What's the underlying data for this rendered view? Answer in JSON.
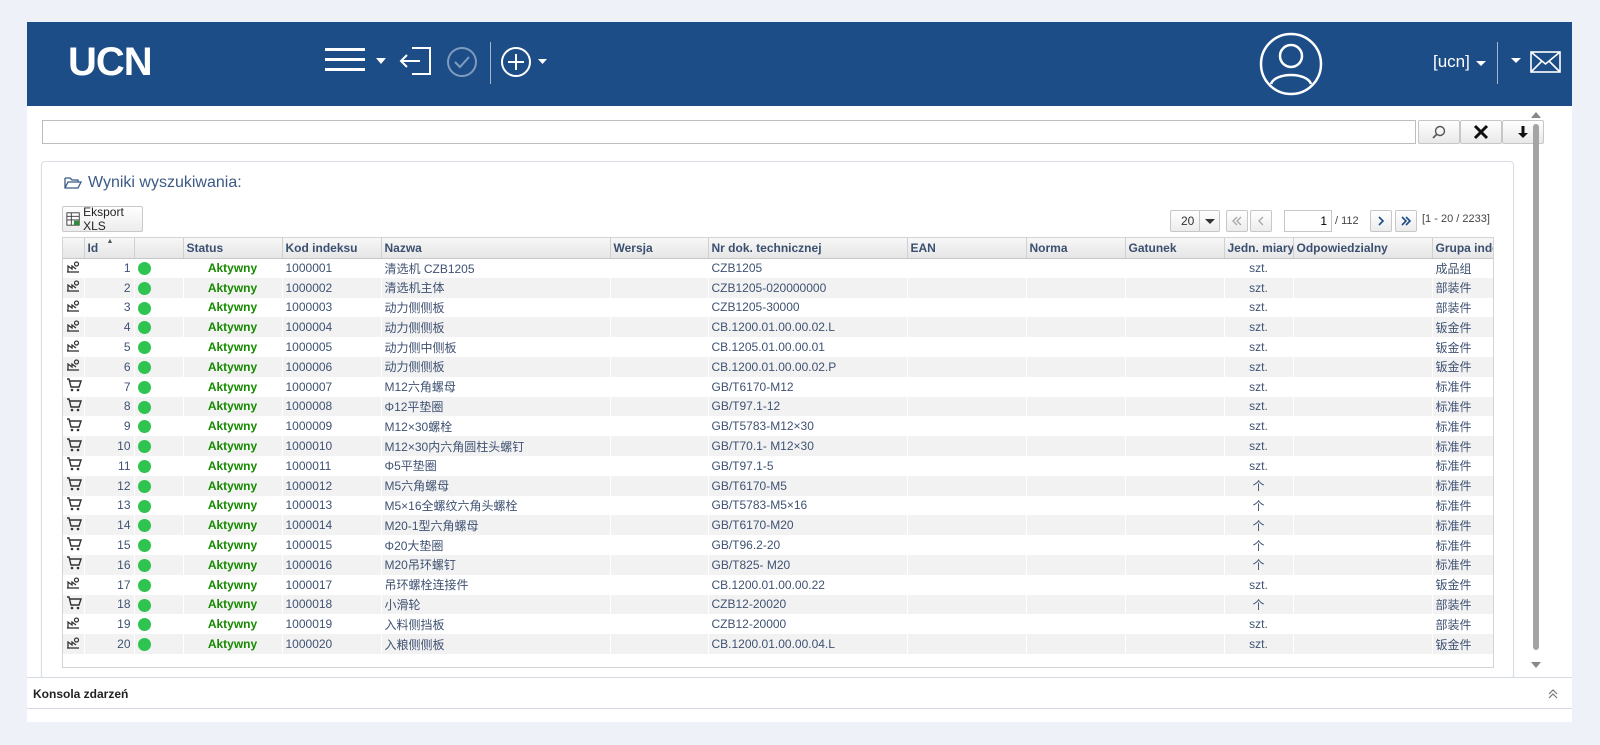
{
  "header": {
    "logo": "UCN",
    "user_name": "[ucn]"
  },
  "search": {
    "value": "",
    "placeholder": ""
  },
  "results": {
    "title": "Wyniki wyszukiwania:",
    "export_label": "Eksport XLS"
  },
  "pagination": {
    "page_size": "20",
    "current_page": "1",
    "total_pages": "/ 112",
    "range": "[1 - 20 / 2233]"
  },
  "columns": [
    "Id",
    "Status",
    "Kod indeksu",
    "Nazwa",
    "Wersja",
    "Nr dok. technicznej",
    "EAN",
    "Norma",
    "Gatunek",
    "Jedn. miary",
    "Odpowiedzialny",
    "Grupa indeksów"
  ],
  "rows": [
    {
      "type": "production",
      "id": "1",
      "status": "Aktywny",
      "code": "1000001",
      "name": "清选机 CZB1205",
      "version": "",
      "doc": "CZB1205",
      "ean": "",
      "norm": "",
      "grade": "",
      "unit": "szt.",
      "owner": "",
      "group": "成品组"
    },
    {
      "type": "production",
      "id": "2",
      "status": "Aktywny",
      "code": "1000002",
      "name": "清选机主体",
      "version": "",
      "doc": "CZB1205-020000000",
      "ean": "",
      "norm": "",
      "grade": "",
      "unit": "szt.",
      "owner": "",
      "group": "部装件"
    },
    {
      "type": "production",
      "id": "3",
      "status": "Aktywny",
      "code": "1000003",
      "name": "动力侧侧板",
      "version": "",
      "doc": "CZB1205-30000",
      "ean": "",
      "norm": "",
      "grade": "",
      "unit": "szt.",
      "owner": "",
      "group": "部装件"
    },
    {
      "type": "production",
      "id": "4",
      "status": "Aktywny",
      "code": "1000004",
      "name": "动力侧侧板",
      "version": "",
      "doc": "CB.1200.01.00.00.02.L",
      "ean": "",
      "norm": "",
      "grade": "",
      "unit": "szt.",
      "owner": "",
      "group": "钣金件"
    },
    {
      "type": "production",
      "id": "5",
      "status": "Aktywny",
      "code": "1000005",
      "name": "动力侧中侧板",
      "version": "",
      "doc": "CB.1205.01.00.00.01",
      "ean": "",
      "norm": "",
      "grade": "",
      "unit": "szt.",
      "owner": "",
      "group": "钣金件"
    },
    {
      "type": "production",
      "id": "6",
      "status": "Aktywny",
      "code": "1000006",
      "name": "动力侧侧板",
      "version": "",
      "doc": "CB.1200.01.00.00.02.P",
      "ean": "",
      "norm": "",
      "grade": "",
      "unit": "szt.",
      "owner": "",
      "group": "钣金件"
    },
    {
      "type": "purchase",
      "id": "7",
      "status": "Aktywny",
      "code": "1000007",
      "name": "M12六角螺母",
      "version": "",
      "doc": "GB/T6170-M12",
      "ean": "",
      "norm": "",
      "grade": "",
      "unit": "szt.",
      "owner": "",
      "group": "标准件"
    },
    {
      "type": "purchase",
      "id": "8",
      "status": "Aktywny",
      "code": "1000008",
      "name": "Φ12平垫圈",
      "version": "",
      "doc": "GB/T97.1-12",
      "ean": "",
      "norm": "",
      "grade": "",
      "unit": "szt.",
      "owner": "",
      "group": "标准件"
    },
    {
      "type": "purchase",
      "id": "9",
      "status": "Aktywny",
      "code": "1000009",
      "name": "M12×30螺栓",
      "version": "",
      "doc": "GB/T5783-M12×30",
      "ean": "",
      "norm": "",
      "grade": "",
      "unit": "szt.",
      "owner": "",
      "group": "标准件"
    },
    {
      "type": "purchase",
      "id": "10",
      "status": "Aktywny",
      "code": "1000010",
      "name": "M12×30内六角圆柱头螺钉",
      "version": "",
      "doc": "GB/T70.1- M12×30",
      "ean": "",
      "norm": "",
      "grade": "",
      "unit": "szt.",
      "owner": "",
      "group": "标准件"
    },
    {
      "type": "purchase",
      "id": "11",
      "status": "Aktywny",
      "code": "1000011",
      "name": "Φ5平垫圈",
      "version": "",
      "doc": "GB/T97.1-5",
      "ean": "",
      "norm": "",
      "grade": "",
      "unit": "szt.",
      "owner": "",
      "group": "标准件"
    },
    {
      "type": "purchase",
      "id": "12",
      "status": "Aktywny",
      "code": "1000012",
      "name": "M5六角螺母",
      "version": "",
      "doc": "GB/T6170-M5",
      "ean": "",
      "norm": "",
      "grade": "",
      "unit": "个",
      "owner": "",
      "group": "标准件"
    },
    {
      "type": "purchase",
      "id": "13",
      "status": "Aktywny",
      "code": "1000013",
      "name": "M5×16全螺纹六角头螺栓",
      "version": "",
      "doc": "GB/T5783-M5×16",
      "ean": "",
      "norm": "",
      "grade": "",
      "unit": "个",
      "owner": "",
      "group": "标准件"
    },
    {
      "type": "purchase",
      "id": "14",
      "status": "Aktywny",
      "code": "1000014",
      "name": "M20-1型六角螺母",
      "version": "",
      "doc": "GB/T6170-M20",
      "ean": "",
      "norm": "",
      "grade": "",
      "unit": "个",
      "owner": "",
      "group": "标准件"
    },
    {
      "type": "purchase",
      "id": "15",
      "status": "Aktywny",
      "code": "1000015",
      "name": "Φ20大垫圈",
      "version": "",
      "doc": "GB/T96.2-20",
      "ean": "",
      "norm": "",
      "grade": "",
      "unit": "个",
      "owner": "",
      "group": "标准件"
    },
    {
      "type": "purchase",
      "id": "16",
      "status": "Aktywny",
      "code": "1000016",
      "name": "M20吊环螺钉",
      "version": "",
      "doc": "GB/T825- M20",
      "ean": "",
      "norm": "",
      "grade": "",
      "unit": "个",
      "owner": "",
      "group": "标准件"
    },
    {
      "type": "production",
      "id": "17",
      "status": "Aktywny",
      "code": "1000017",
      "name": "吊环螺栓连接件",
      "version": "",
      "doc": "CB.1200.01.00.00.22",
      "ean": "",
      "norm": "",
      "grade": "",
      "unit": "szt.",
      "owner": "",
      "group": "钣金件"
    },
    {
      "type": "purchase",
      "id": "18",
      "status": "Aktywny",
      "code": "1000018",
      "name": "小滑轮",
      "version": "",
      "doc": "CZB12-20020",
      "ean": "",
      "norm": "",
      "grade": "",
      "unit": "个",
      "owner": "",
      "group": "部装件"
    },
    {
      "type": "production",
      "id": "19",
      "status": "Aktywny",
      "code": "1000019",
      "name": "入料侧挡板",
      "version": "",
      "doc": "CZB12-20000",
      "ean": "",
      "norm": "",
      "grade": "",
      "unit": "szt.",
      "owner": "",
      "group": "部装件"
    },
    {
      "type": "production",
      "id": "20",
      "status": "Aktywny",
      "code": "1000020",
      "name": "入粮侧侧板",
      "version": "",
      "doc": "CB.1200.01.00.00.04.L",
      "ean": "",
      "norm": "",
      "grade": "",
      "unit": "szt.",
      "owner": "",
      "group": "钣金件"
    }
  ],
  "console": {
    "label": "Konsola zdarzeń"
  },
  "colors": {
    "header_bg": "#1c4d87",
    "status_active": "#168a00",
    "status_dot": "#2ec44f"
  }
}
